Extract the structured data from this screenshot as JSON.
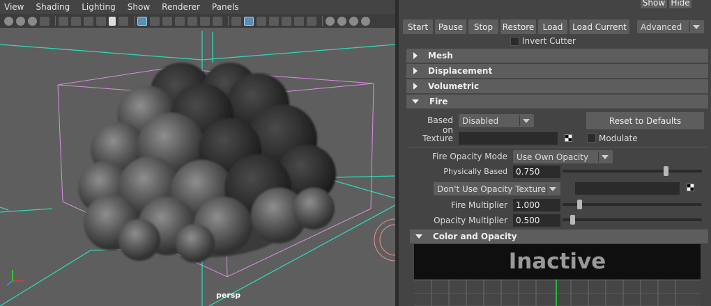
{
  "viewport": {
    "menu": [
      "View",
      "Shading",
      "Lighting",
      "Show",
      "Renderer",
      "Panels"
    ],
    "camera_label": "persp"
  },
  "panel": {
    "top_buttons": {
      "show": "Show",
      "hide": "Hide"
    },
    "actions": [
      "Start",
      "Pause",
      "Stop",
      "Restore",
      "Load",
      "Load Current"
    ],
    "mode_select": "Advanced",
    "invert_cutter_label": "Invert Cutter",
    "sections": {
      "mesh": "Mesh",
      "displacement": "Displacement",
      "volumetric": "Volumetric",
      "fire": "Fire",
      "color_opacity": "Color and Opacity"
    },
    "fire": {
      "based_on_label": "Based on",
      "based_on_value": "Disabled",
      "reset_button": "Reset to Defaults",
      "texture_label": "Texture",
      "modulate_label": "Modulate",
      "opacity_mode_label": "Fire Opacity Mode",
      "opacity_mode_value": "Use Own Opacity",
      "physically_based_label": "Physically Based",
      "physically_based_value": "0.750",
      "opacity_texture_value": "Don't Use Opacity Texture",
      "fire_multiplier_label": "Fire Multiplier",
      "fire_multiplier_value": "1.000",
      "opacity_multiplier_label": "Opacity Multiplier",
      "opacity_multiplier_value": "0.500"
    },
    "gradient_status": "Inactive"
  }
}
